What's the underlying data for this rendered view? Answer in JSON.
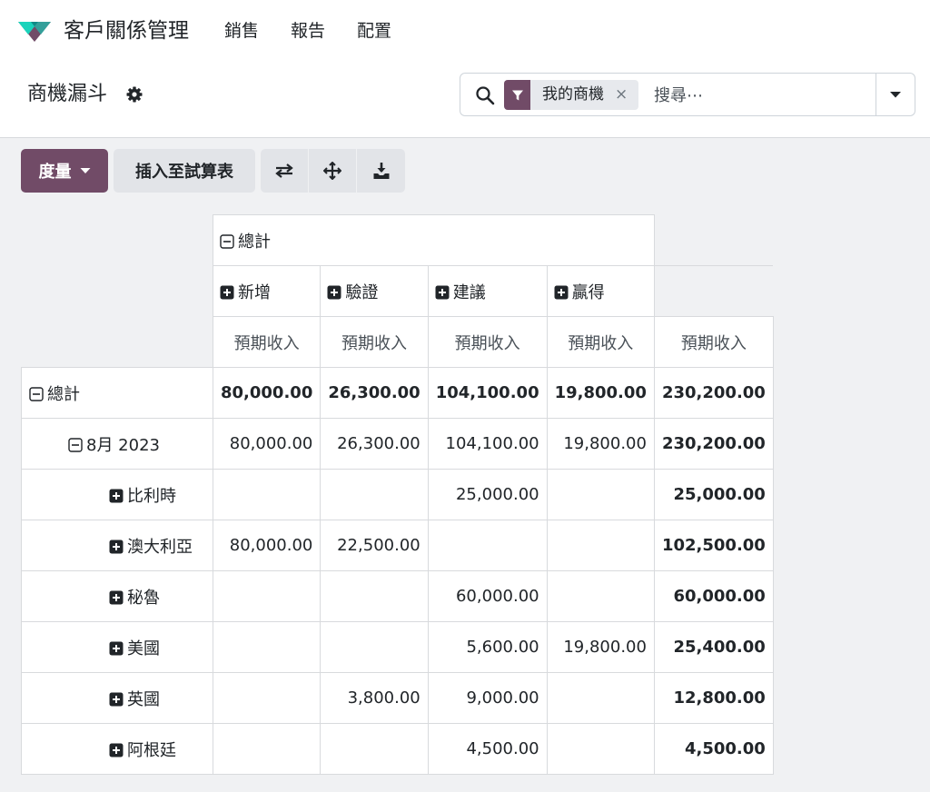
{
  "navbar": {
    "app_title": "客戶關係管理",
    "menu": [
      "銷售",
      "報告",
      "配置"
    ]
  },
  "control_panel": {
    "title": "商機漏斗",
    "search": {
      "facet_label": "我的商機",
      "facet_remove": "×",
      "placeholder": "搜尋⋯"
    }
  },
  "toolbar": {
    "measures_label": "度量",
    "insert_label": "插入至試算表",
    "icons": [
      "flip-axis-icon",
      "expand-all-icon",
      "download-icon"
    ]
  },
  "pivot": {
    "col_total": "總計",
    "col_groups": [
      "新增",
      "驗證",
      "建議",
      "贏得"
    ],
    "measure": "預期收入",
    "rows": [
      {
        "label": "總計",
        "level": 0,
        "expanded": true,
        "bold": true,
        "values": [
          "80,000.00",
          "26,300.00",
          "104,100.00",
          "19,800.00",
          "230,200.00"
        ]
      },
      {
        "label": "8月 2023",
        "level": 1,
        "expanded": true,
        "bold": false,
        "values": [
          "80,000.00",
          "26,300.00",
          "104,100.00",
          "19,800.00",
          "230,200.00"
        ]
      },
      {
        "label": "比利時",
        "level": 2,
        "expanded": false,
        "bold": false,
        "values": [
          "",
          "",
          "25,000.00",
          "",
          "25,000.00"
        ]
      },
      {
        "label": "澳大利亞",
        "level": 2,
        "expanded": false,
        "bold": false,
        "values": [
          "80,000.00",
          "22,500.00",
          "",
          "",
          "102,500.00"
        ]
      },
      {
        "label": "秘魯",
        "level": 2,
        "expanded": false,
        "bold": false,
        "values": [
          "",
          "",
          "60,000.00",
          "",
          "60,000.00"
        ]
      },
      {
        "label": "美國",
        "level": 2,
        "expanded": false,
        "bold": false,
        "values": [
          "",
          "",
          "5,600.00",
          "19,800.00",
          "25,400.00"
        ]
      },
      {
        "label": "英國",
        "level": 2,
        "expanded": false,
        "bold": false,
        "values": [
          "",
          "3,800.00",
          "9,000.00",
          "",
          "12,800.00"
        ]
      },
      {
        "label": "阿根廷",
        "level": 2,
        "expanded": false,
        "bold": false,
        "values": [
          "",
          "",
          "4,500.00",
          "",
          "4,500.00"
        ]
      }
    ]
  },
  "colors": {
    "brand": "#714b67",
    "brand_logo_teal": "#1ad3bb",
    "brand_logo_purple": "#714b67",
    "border": "#d8dadd",
    "background": "#f0f1f3"
  }
}
